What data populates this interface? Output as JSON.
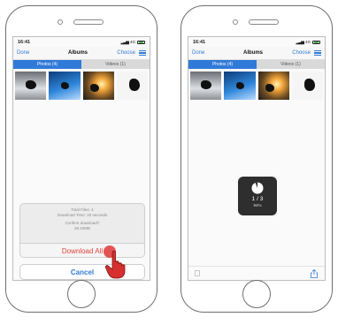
{
  "left_phone": {
    "status": {
      "time": "16:41",
      "network": "4G"
    },
    "nav": {
      "left": "Done",
      "title": "Albums",
      "right": "Choose"
    },
    "tabs": [
      {
        "label": "Photos (4)"
      },
      {
        "label": "Videos (1)"
      }
    ],
    "sheet": {
      "total_files": "Total Files: 4",
      "download_time": "Download Time: 20 seconds",
      "confirm": "Confirm download?",
      "size": "28.16MB",
      "download_label": "Download All",
      "cancel_label": "Cancel"
    }
  },
  "right_phone": {
    "status": {
      "time": "16:41",
      "network": "4G"
    },
    "nav": {
      "left": "Done",
      "title": "Albums",
      "right": "Choose"
    },
    "tabs": [
      {
        "label": "Photos (4)"
      },
      {
        "label": "Videos (1)"
      }
    ],
    "progress": {
      "count": "1 / 3",
      "percent": "94%",
      "fraction": 0.94
    }
  },
  "icons": {
    "list": "list-icon",
    "trash": "trash-icon",
    "share": "share-icon",
    "hand": "hand-pointer-icon"
  },
  "colors": {
    "accent": "#2f7ad8",
    "destructive": "#e0433b",
    "hud": "#2e2e2e"
  }
}
